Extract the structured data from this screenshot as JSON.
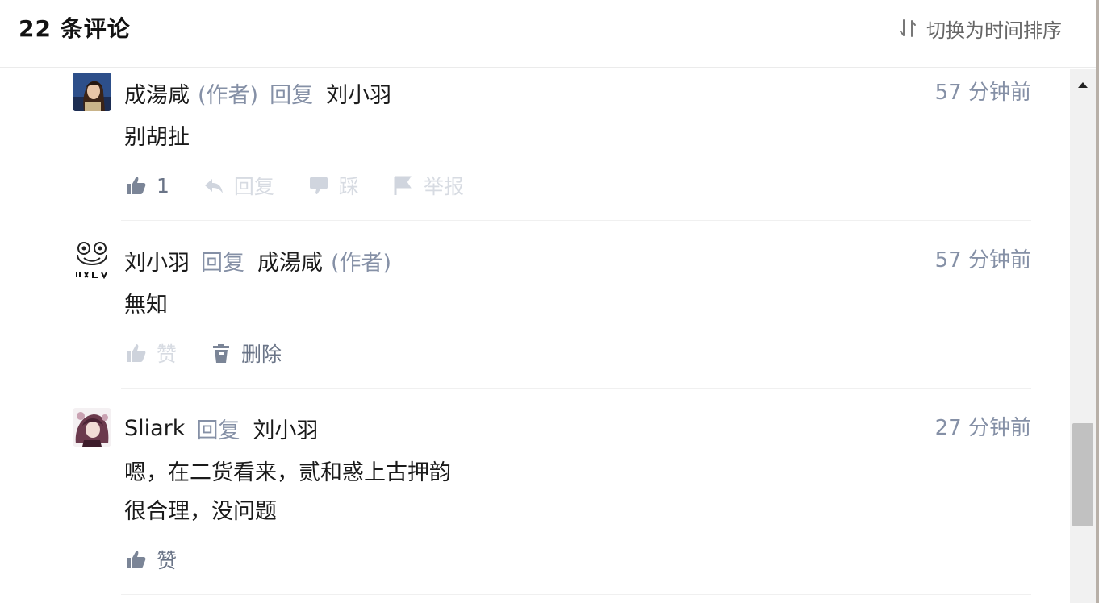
{
  "header": {
    "title": "22 条评论",
    "sort_label": "切换为时间排序"
  },
  "comments": [
    {
      "author": "成湯咸",
      "author_tag": "(作者)",
      "reply_word": "回复",
      "reply_to": "刘小羽",
      "reply_to_tag": "",
      "time": "57 分钟前",
      "body": [
        "别胡扯"
      ],
      "actions": {
        "like_count": "1",
        "reply": "回复",
        "step": "踩",
        "report": "举报"
      }
    },
    {
      "author": "刘小羽",
      "author_tag": "",
      "reply_word": "回复",
      "reply_to": "成湯咸",
      "reply_to_tag": "(作者)",
      "time": "57 分钟前",
      "body": [
        "無知"
      ],
      "actions": {
        "like": "赞",
        "delete": "删除"
      }
    },
    {
      "author": "Sliark",
      "author_tag": "",
      "reply_word": "回复",
      "reply_to": "刘小羽",
      "reply_to_tag": "",
      "time": "27 分钟前",
      "body": [
        "嗯，在二货看来，贰和惑上古押韵",
        "很合理，没问题"
      ],
      "actions": {
        "like": "赞"
      }
    }
  ],
  "icons": {
    "sort": "sort-arrows-icon",
    "like": "thumbs-up-icon",
    "reply": "reply-arrow-icon",
    "step": "thumbs-down-icon",
    "report": "flag-icon",
    "delete": "trash-icon",
    "scroll_up": "scroll-up-arrow-icon"
  },
  "colors": {
    "primary_text": "#1a1a1a",
    "secondary_text": "#8590a6",
    "action_muted": "#b5bcc8",
    "action_active": "#6a7487"
  }
}
